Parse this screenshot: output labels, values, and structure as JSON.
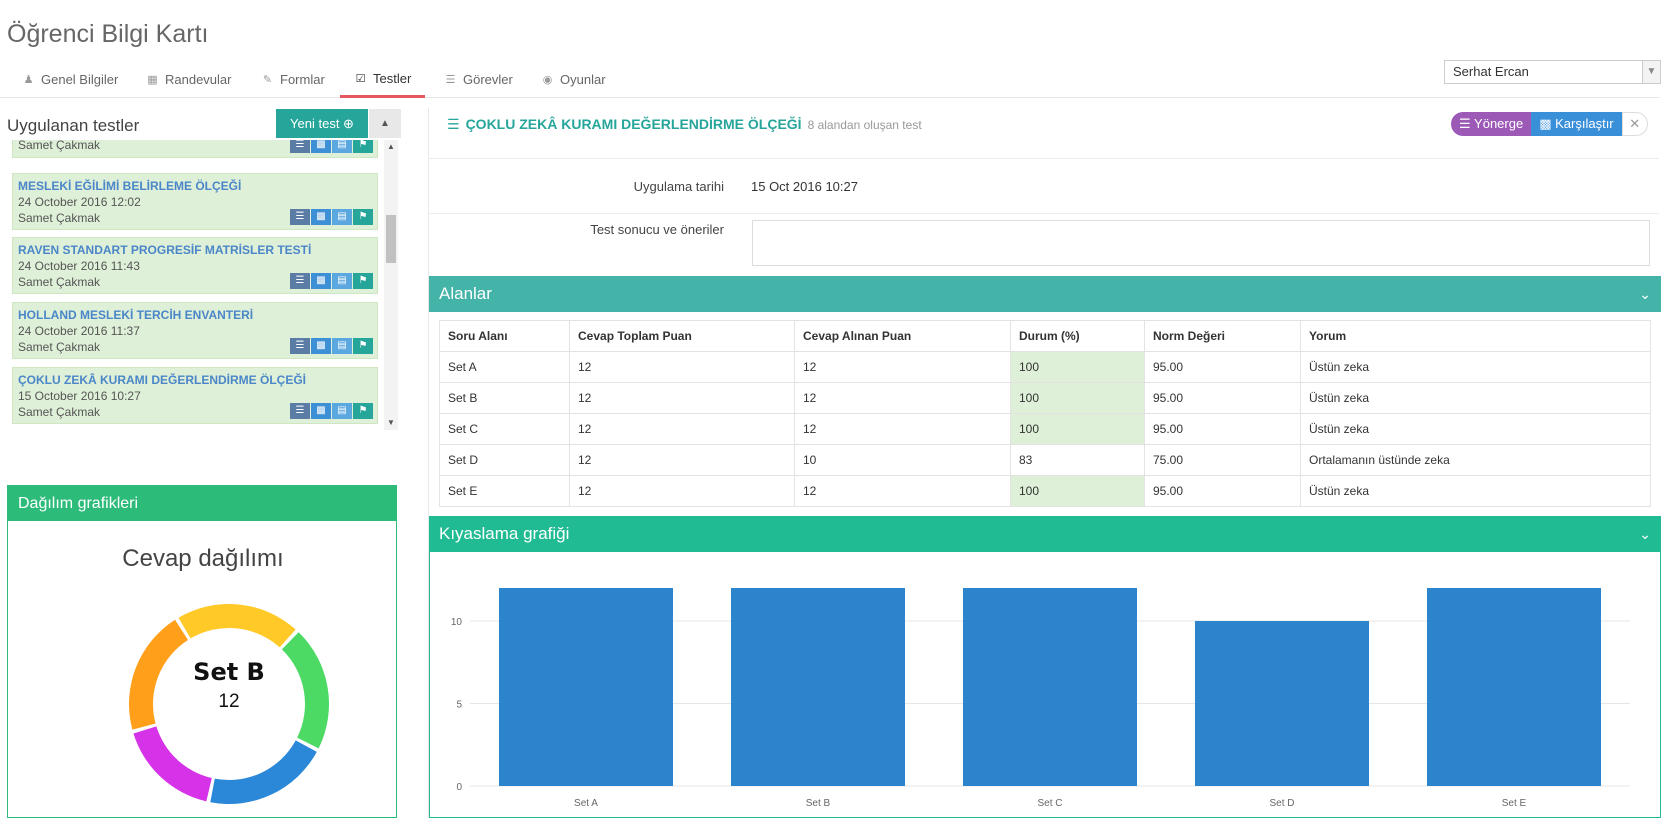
{
  "page": {
    "title": "Öğrenci Bilgi Kartı"
  },
  "tabs": [
    {
      "label": "Genel Bilgiler",
      "icon": "user-icon"
    },
    {
      "label": "Randevular",
      "icon": "calendar-icon"
    },
    {
      "label": "Formlar",
      "icon": "edit-icon"
    },
    {
      "label": "Testler",
      "icon": "check-square-icon",
      "active": true
    },
    {
      "label": "Görevler",
      "icon": "list-icon"
    },
    {
      "label": "Oyunlar",
      "icon": "gamepad-icon"
    }
  ],
  "user_select": {
    "value": "Serhat Ercan"
  },
  "left": {
    "heading": "Uygulanan testler",
    "new_test_label": "Yeni test ⊕",
    "items": [
      {
        "name": "",
        "date": "",
        "user": "Samet Çakmak"
      },
      {
        "name": "MESLEKİ EĞİLİMİ BELİRLEME ÖLÇEĞİ",
        "date": "24 October 2016 12:02",
        "user": "Samet Çakmak"
      },
      {
        "name": "RAVEN STANDART PROGRESİF MATRİSLER TESTİ",
        "date": "24 October 2016 11:43",
        "user": "Samet Çakmak"
      },
      {
        "name": "HOLLAND MESLEKİ TERCİH ENVANTERİ",
        "date": "24 October 2016 11:37",
        "user": "Samet Çakmak"
      },
      {
        "name": "ÇOKLU ZEKÂ KURAMI DEĞERLENDİRME ÖLÇEĞİ",
        "date": "15 October 2016 10:27",
        "user": "Samet Çakmak"
      }
    ]
  },
  "distribution": {
    "header": "Dağılım grafikleri",
    "title": "Cevap dağılımı",
    "center_label": "Set B",
    "center_value": "12",
    "segments": [
      {
        "name": "Set A",
        "value": 12,
        "color": "#ffca28"
      },
      {
        "name": "Set B",
        "value": 12,
        "color": "#4cd964"
      },
      {
        "name": "Set C",
        "value": 12,
        "color": "#2b88d8"
      },
      {
        "name": "Set D",
        "value": 10,
        "color": "#d633e8"
      },
      {
        "name": "Set E",
        "value": 12,
        "color": "#ff9f1a"
      }
    ]
  },
  "test": {
    "title": "ÇOKLU ZEKÂ KURAMI DEĞERLENDİRME ÖLÇEĞİ",
    "subtitle": "8 alandan oluşan test",
    "btn_yonerge": "Yönerge",
    "btn_karsilastir": "Karşılaştır",
    "btn_close": "✕",
    "date_label": "Uygulama tarihi",
    "date_value": "15 Oct 2016 10:27",
    "result_label": "Test sonucu ve öneriler"
  },
  "areas": {
    "header": "Alanlar",
    "columns": [
      "Soru Alanı",
      "Cevap Toplam Puan",
      "Cevap Alınan Puan",
      "Durum (%)",
      "Norm Değeri",
      "Yorum"
    ],
    "rows": [
      [
        "Set A",
        "12",
        "12",
        "100",
        "95.00",
        "Üstün zeka"
      ],
      [
        "Set B",
        "12",
        "12",
        "100",
        "95.00",
        "Üstün zeka"
      ],
      [
        "Set C",
        "12",
        "12",
        "100",
        "95.00",
        "Üstün zeka"
      ],
      [
        "Set D",
        "12",
        "10",
        "83",
        "75.00",
        "Ortalamanın üstünde zeka"
      ],
      [
        "Set E",
        "12",
        "12",
        "100",
        "95.00",
        "Üstün zeka"
      ]
    ]
  },
  "comparison": {
    "header": "Kıyaslama grafiği"
  },
  "chart_data": {
    "type": "bar",
    "title": "",
    "xlabel": "",
    "ylabel": "",
    "categories": [
      "Set A",
      "Set B",
      "Set C",
      "Set D",
      "Set E"
    ],
    "values": [
      12,
      12,
      12,
      10,
      12
    ],
    "yticks": [
      0,
      5,
      10
    ],
    "ylim": [
      0,
      12
    ],
    "bar_color": "#2b84cc",
    "grid": true
  }
}
